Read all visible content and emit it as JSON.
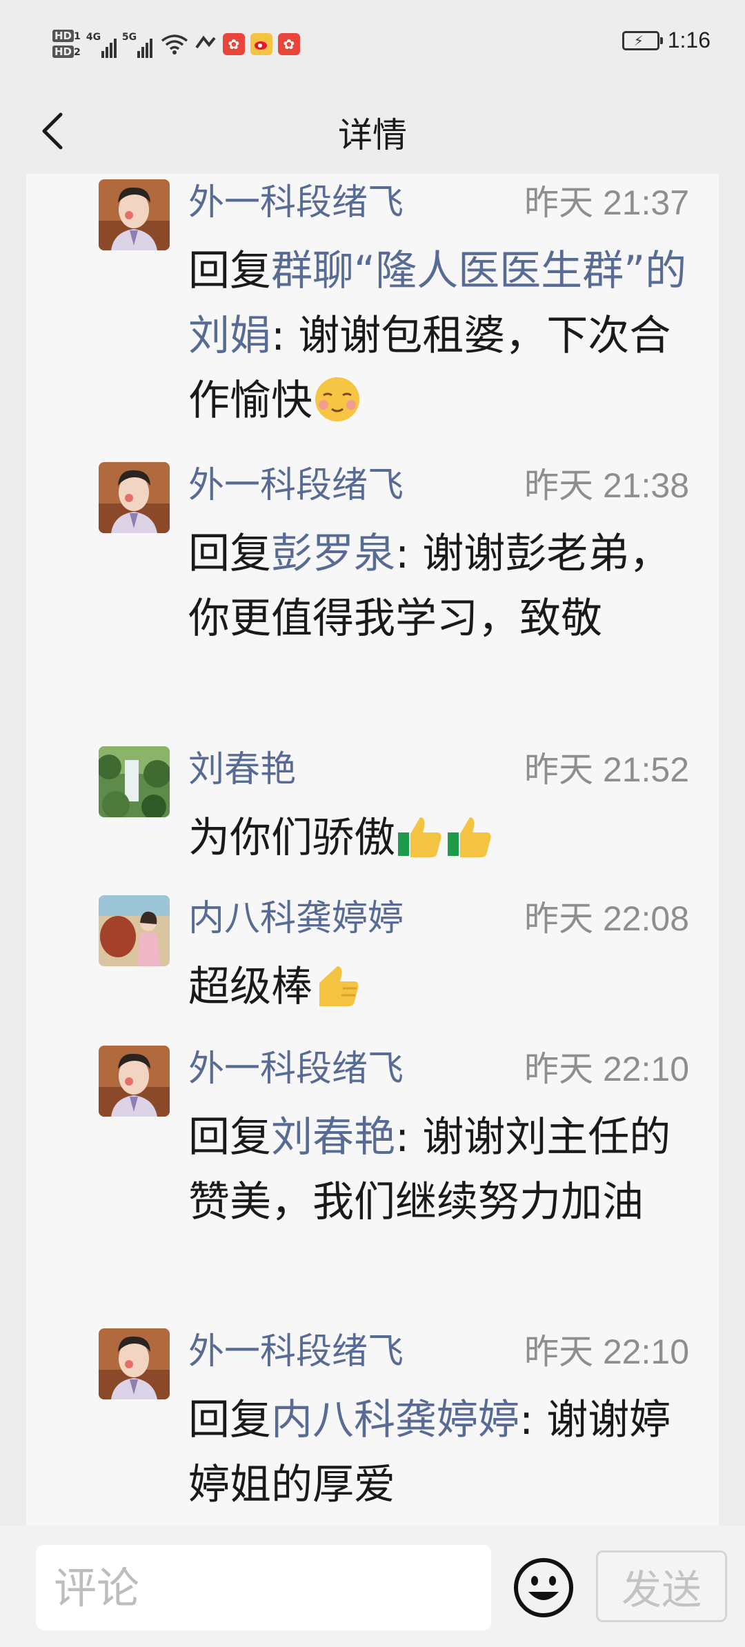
{
  "status_bar": {
    "hd1": "HD",
    "hd1_sub": "1",
    "hd2": "HD",
    "hd2_sub": "2",
    "net1": "4G",
    "net2": "5G",
    "time": "1:16"
  },
  "nav": {
    "title": "详情"
  },
  "comments": [
    {
      "author": "外一科段绪飞",
      "time": "昨天 21:37",
      "prefix": "回复",
      "reply_to": "群聊“隆人医医生群”的刘娟",
      "body": ": 谢谢包租婆，下次合作愉快",
      "emojis": [
        "blushing-face"
      ]
    },
    {
      "author": "外一科段绪飞",
      "time": "昨天 21:38",
      "prefix": "回复",
      "reply_to": "彭罗泉",
      "body": ": 谢谢彭老弟，你更值得我学习，致敬",
      "emojis": []
    },
    {
      "author": "刘春艳",
      "time": "昨天 21:52",
      "prefix": "",
      "reply_to": "",
      "body": "为你们骄傲",
      "emojis": [
        "thumbs-up",
        "thumbs-up"
      ]
    },
    {
      "author": "内八科龚婷婷",
      "time": "昨天 22:08",
      "prefix": "",
      "reply_to": "",
      "body": "超级棒",
      "emojis": [
        "thumbs-up"
      ]
    },
    {
      "author": "外一科段绪飞",
      "time": "昨天 22:10",
      "prefix": "回复",
      "reply_to": "刘春艳",
      "body": ": 谢谢刘主任的赞美，我们继续努力加油",
      "emojis": []
    },
    {
      "author": "外一科段绪飞",
      "time": "昨天 22:10",
      "prefix": "回复",
      "reply_to": "内八科龚婷婷",
      "body": ": 谢谢婷婷姐的厚爱",
      "emojis": []
    }
  ],
  "input_bar": {
    "placeholder": "评论",
    "send_label": "发送"
  },
  "colors": {
    "link": "#576b95",
    "timestamp": "#8e8e8e",
    "background": "#ededed"
  }
}
